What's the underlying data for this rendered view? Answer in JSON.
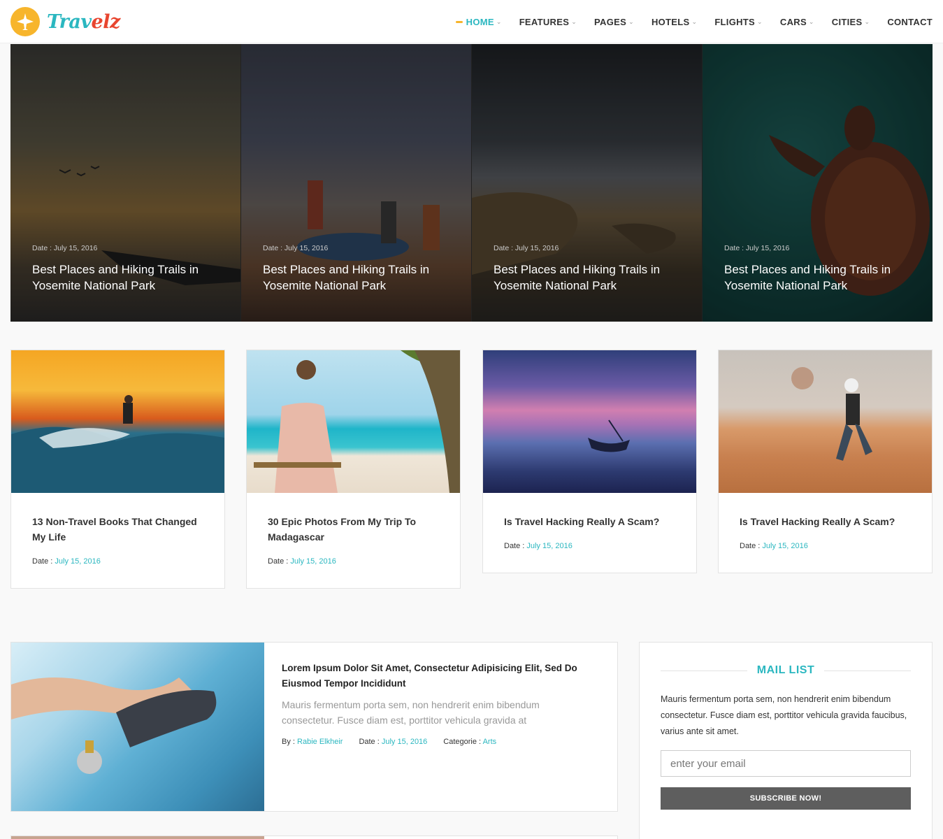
{
  "brand": {
    "name_part1": "Trav",
    "name_part2": "elz"
  },
  "nav": {
    "items": [
      {
        "label": "HOME",
        "active": true,
        "has_dropdown": true
      },
      {
        "label": "FEATURES",
        "has_dropdown": true
      },
      {
        "label": "PAGES",
        "has_dropdown": true
      },
      {
        "label": "HOTELS",
        "has_dropdown": true
      },
      {
        "label": "FLIGHTS",
        "has_dropdown": true
      },
      {
        "label": "CARS",
        "has_dropdown": true
      },
      {
        "label": "CITIES",
        "has_dropdown": true
      },
      {
        "label": "CONTACT",
        "has_dropdown": false
      }
    ]
  },
  "hero": {
    "posts": [
      {
        "date": "Date : July 15, 2016",
        "title": "Best Places and Hiking Trails in Yosemite National Park"
      },
      {
        "date": "Date : July 15, 2016",
        "title": "Best Places and Hiking Trails in Yosemite National Park"
      },
      {
        "date": "Date : July 15, 2016",
        "title": "Best Places and Hiking Trails in Yosemite National Park"
      },
      {
        "date": "Date : July 15, 2016",
        "title": "Best Places and Hiking Trails in Yosemite National Park"
      }
    ]
  },
  "cards": [
    {
      "title": "13 Non-Travel Books That Changed My Life",
      "date_label": "Date :",
      "date": "July 15, 2016"
    },
    {
      "title": "30 Epic Photos From My Trip To Madagascar",
      "date_label": "Date :",
      "date": "July 15, 2016"
    },
    {
      "title": "Is Travel Hacking Really A Scam?",
      "date_label": "Date :",
      "date": "July 15, 2016"
    },
    {
      "title": "Is Travel Hacking Really A Scam?",
      "date_label": "Date :",
      "date": "July 15, 2016"
    }
  ],
  "featured": {
    "title": "Lorem Ipsum Dolor Sit Amet, Consectetur Adipisicing Elit, Sed Do Eiusmod Tempor Incididunt",
    "excerpt": "Mauris fermentum porta sem, non hendrerit enim bibendum consectetur. Fusce diam est, porttitor vehicula gravida at",
    "by_label": "By :",
    "author": "Rabie Elkheir",
    "date_label": "Date :",
    "date": "July 15, 2016",
    "category_label": "Categorie :",
    "category": "Arts"
  },
  "mail_list": {
    "heading": "MAIL LIST",
    "text": "Mauris fermentum porta sem, non hendrerit enim bibendum consectetur. Fusce diam est, porttitor vehicula gravida faucibus, varius ante sit amet.",
    "email_placeholder": "enter your email",
    "button_label": "SUBSCRIBE NOW!"
  },
  "colors": {
    "accent": "#2bb7c0",
    "brand_yellow": "#f7b52c",
    "brand_red": "#e8452f",
    "button_gray": "#5e5e5e"
  }
}
